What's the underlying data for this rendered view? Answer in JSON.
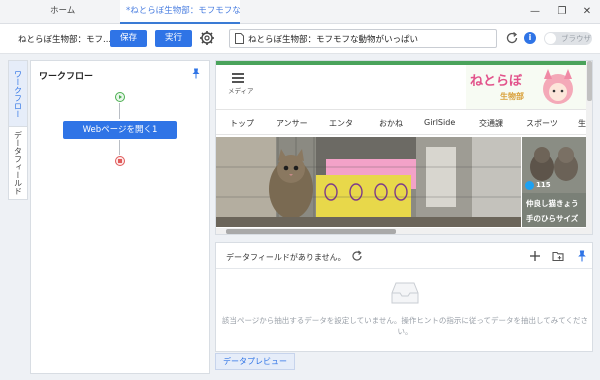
{
  "tabs": {
    "home": "ホーム",
    "active": "*ねとらぼ生物部：モフモフな"
  },
  "toolbar": {
    "title": "ねとらぼ生物部：モフ...",
    "save_label": "保存",
    "run_label": "実行",
    "url": "ねとらぼ生物部：モフモフな動物がいっぱい",
    "browser_toggle_label": "ブラウザ"
  },
  "side_tabs": {
    "workflow": "ワークフロー",
    "datafield": "データフィールド"
  },
  "workflow": {
    "title": "ワークフロー",
    "node_label": "Webページを開く1"
  },
  "site": {
    "menu_label": "メディア",
    "logo_text": "ねとらぼ生物部",
    "nav": [
      "トップ",
      "アンサー",
      "エンタ",
      "おかね",
      "GirlSide",
      "交通課",
      "スポーツ",
      "生"
    ],
    "side_count": "115",
    "side_title1": "仲良し猫きょう",
    "side_title2": "手のひらサイズ"
  },
  "data": {
    "no_fields_msg": "データフィールドがありません。",
    "empty_text": "該当ページから抽出するデータを設定していません。操作ヒントの指示に従ってデータを抽出してみてください。",
    "preview_tab": "データプレビュー"
  },
  "colors": {
    "accent": "#2f74e6",
    "site_green": "#4aa35b"
  },
  "icons": [
    "gear-icon",
    "document-icon",
    "refresh-icon",
    "info-icon",
    "pin-icon",
    "start-icon",
    "stop-icon",
    "plus-icon",
    "add-folder-icon",
    "inbox-icon",
    "hamburger-icon"
  ]
}
